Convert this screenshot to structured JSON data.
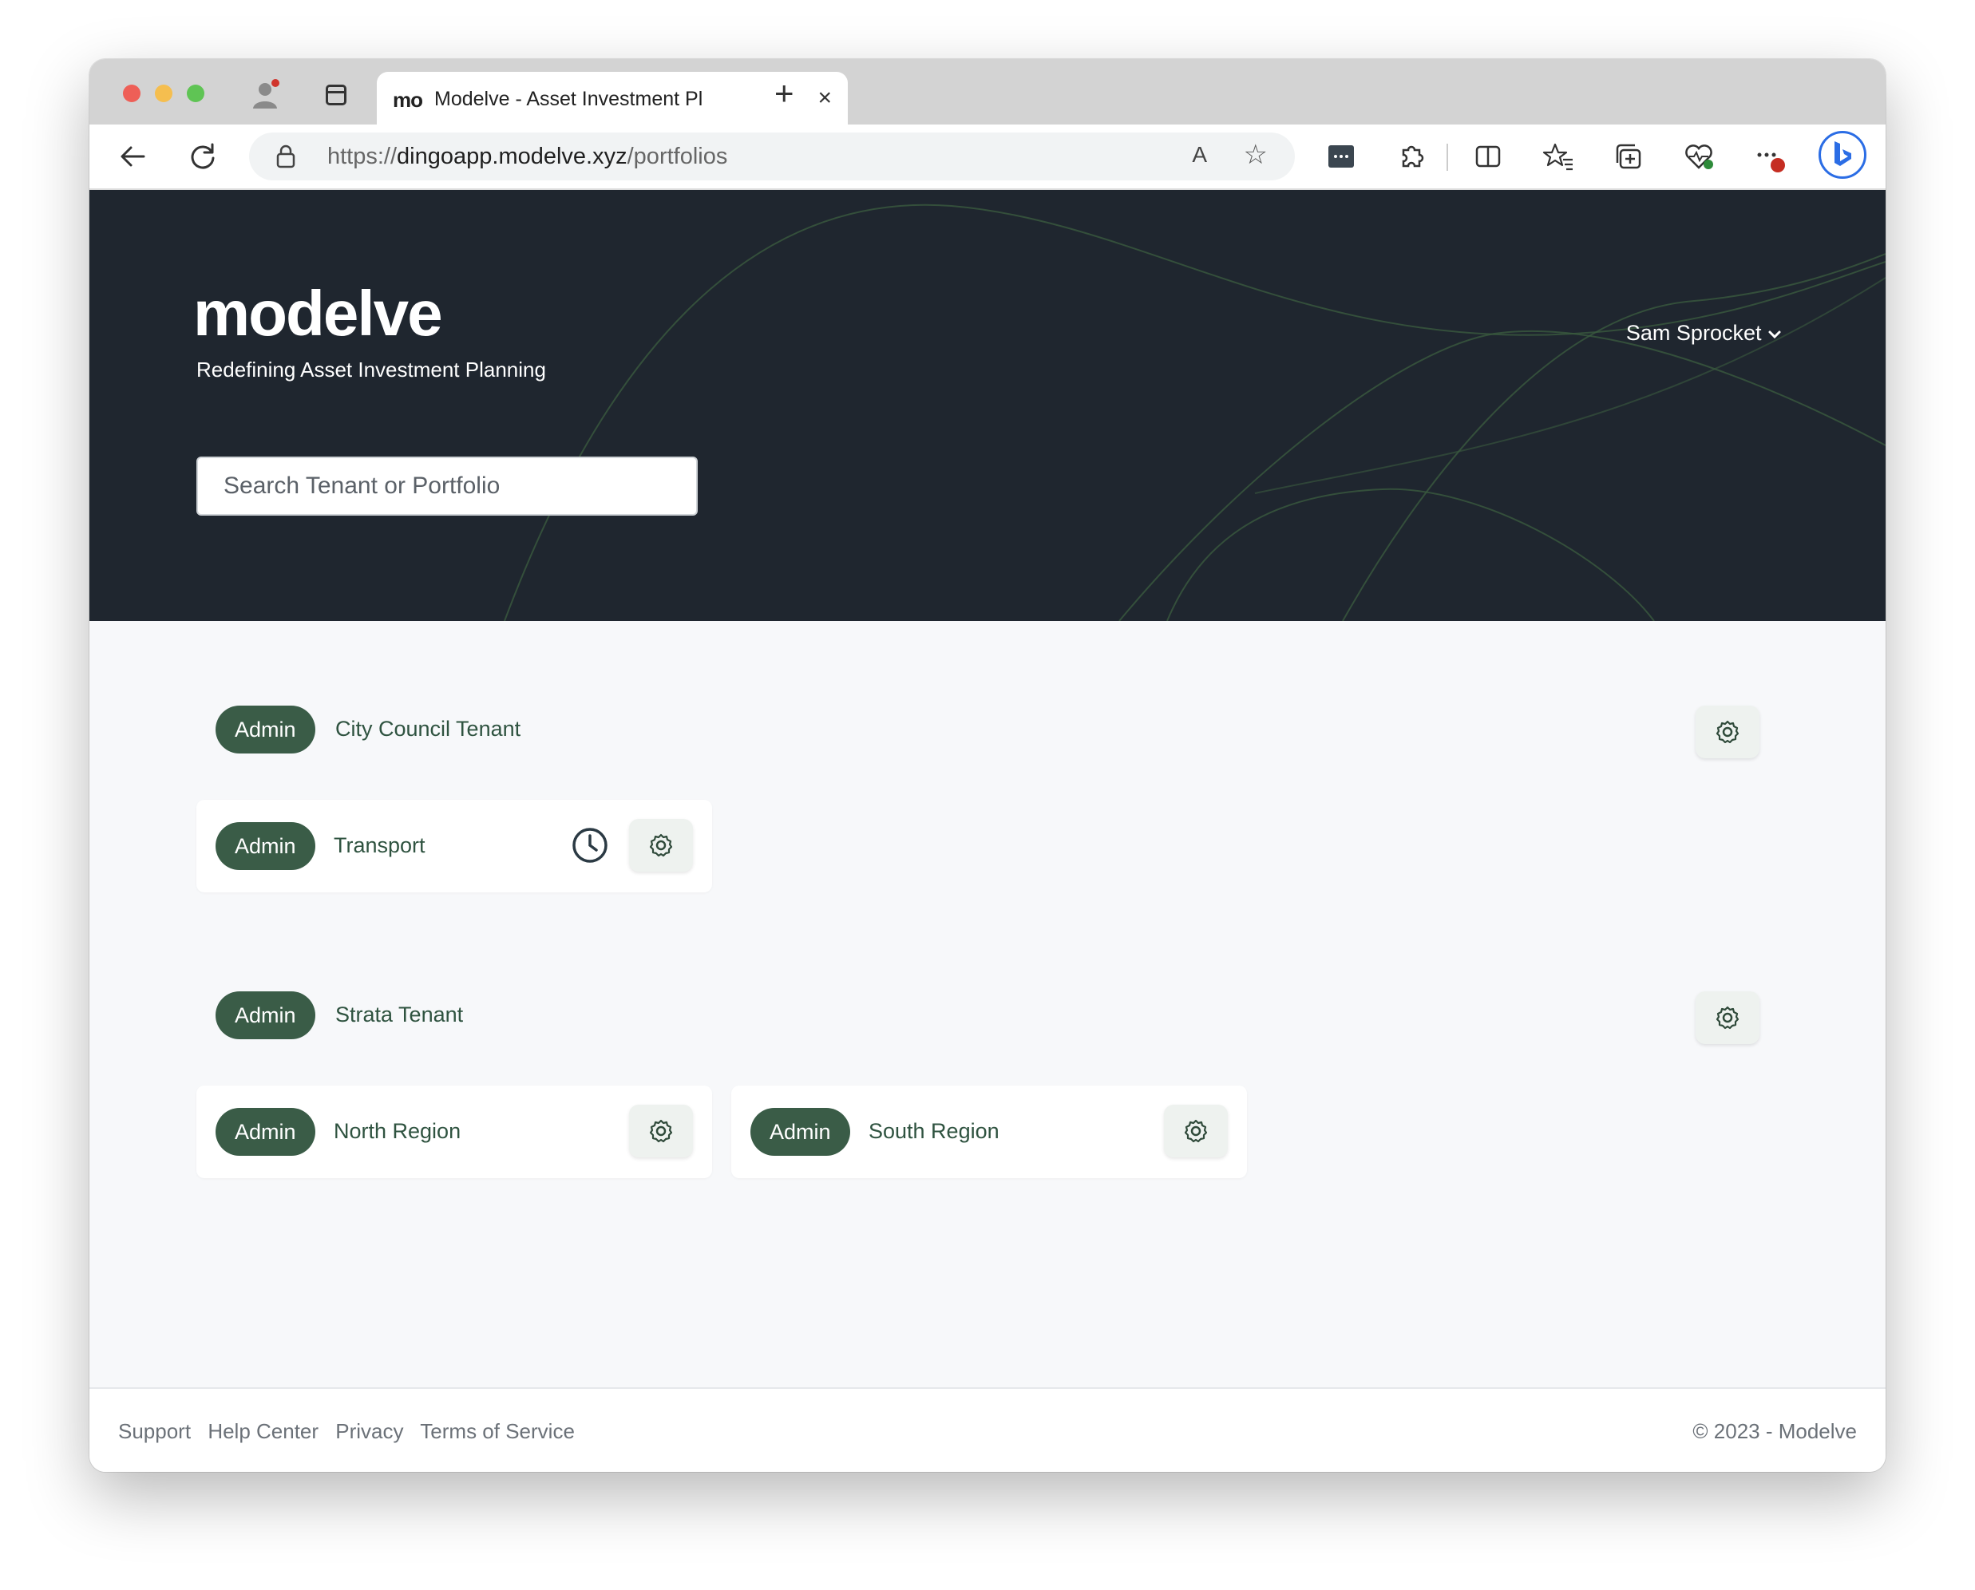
{
  "browser": {
    "tab_title": "Modelve - Asset Investment Pl",
    "tab_favicon": "mo",
    "new_tab_symbol": "+",
    "close_symbol": "×",
    "url_prefix": "https://",
    "url_domain": "dingoapp.modelve.xyz",
    "url_path": "/portfolios",
    "read_aloud": "A",
    "favorite_symbol": "☆"
  },
  "header": {
    "logo": "modelve",
    "tagline": "Redefining Asset Investment Planning",
    "user_name": "Sam Sprocket",
    "search_placeholder": "Search Tenant or Portfolio"
  },
  "tenants": [
    {
      "role": "Admin",
      "name": "City Council Tenant",
      "portfolios": [
        {
          "role": "Admin",
          "name": "Transport",
          "has_history": true
        }
      ]
    },
    {
      "role": "Admin",
      "name": "Strata Tenant",
      "portfolios": [
        {
          "role": "Admin",
          "name": "North Region",
          "has_history": false
        },
        {
          "role": "Admin",
          "name": "South Region",
          "has_history": false
        }
      ]
    }
  ],
  "footer": {
    "links": [
      "Support",
      "Help Center",
      "Privacy",
      "Terms of Service"
    ],
    "copyright": "© 2023 - Modelve"
  },
  "colors": {
    "header_bg": "#1f262f",
    "pill_bg": "#3a5c47",
    "accent_text": "#2f5340",
    "page_bg": "#f7f8fa"
  },
  "icons": [
    "profile-icon",
    "tab-actions-icon",
    "back-icon",
    "reload-icon",
    "lock-icon",
    "read-aloud-icon",
    "favorite-star-icon",
    "password-icon",
    "extensions-icon",
    "split-screen-icon",
    "favorites-icon",
    "collections-icon",
    "browser-essentials-icon",
    "more-icon",
    "bing-icon",
    "gear-icon",
    "clock-icon",
    "chevron-down-icon"
  ]
}
